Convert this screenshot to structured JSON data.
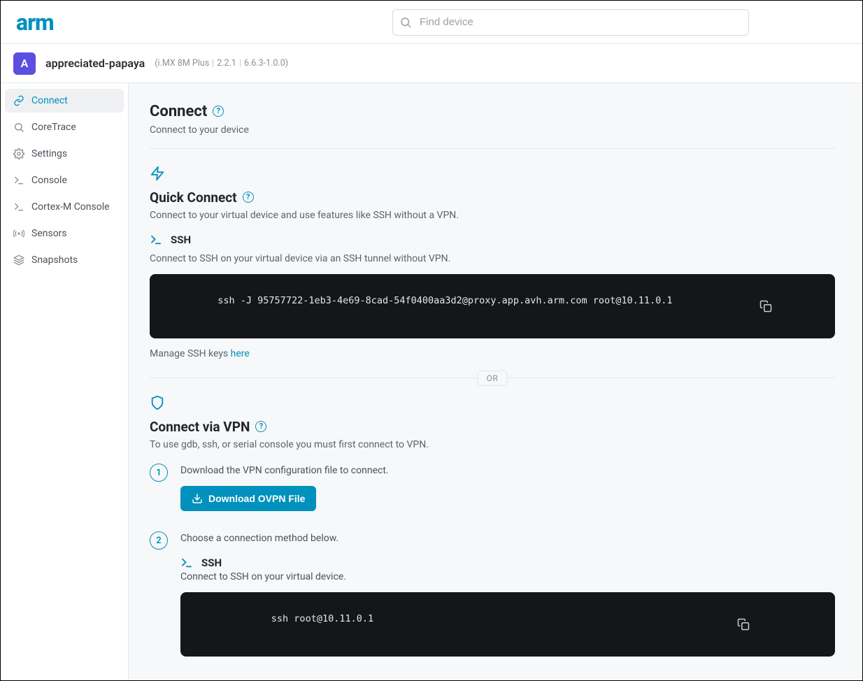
{
  "brand": "arm",
  "search": {
    "placeholder": "Find device"
  },
  "device": {
    "avatar": "A",
    "name": "appreciated-papaya",
    "meta_prefix": "(",
    "meta_model": "i.MX 8M Plus",
    "meta_fw": "2.2.1",
    "meta_kernel": "6.6.3-1.0.0",
    "meta_suffix": ")"
  },
  "sidebar": {
    "items": [
      {
        "id": "connect",
        "label": "Connect",
        "icon": "link-icon",
        "active": true
      },
      {
        "id": "coretrace",
        "label": "CoreTrace",
        "icon": "magnifier-icon",
        "active": false
      },
      {
        "id": "settings",
        "label": "Settings",
        "icon": "gear-icon",
        "active": false
      },
      {
        "id": "console",
        "label": "Console",
        "icon": "terminal-icon",
        "active": false
      },
      {
        "id": "cortexm",
        "label": "Cortex-M Console",
        "icon": "terminal-icon",
        "active": false
      },
      {
        "id": "sensors",
        "label": "Sensors",
        "icon": "signal-icon",
        "active": false
      },
      {
        "id": "snapshots",
        "label": "Snapshots",
        "icon": "stack-icon",
        "active": false
      }
    ]
  },
  "connect": {
    "title": "Connect",
    "subtitle": "Connect to your device",
    "quick": {
      "title": "Quick Connect",
      "subtitle": "Connect to your virtual device and use features like SSH without a VPN.",
      "ssh_label": "SSH",
      "ssh_desc": "Connect to SSH on your virtual device via an SSH tunnel without VPN.",
      "ssh_cmd": "ssh -J 95757722-1eb3-4e69-8cad-54f0400aa3d2@proxy.app.avh.arm.com root@10.11.0.1",
      "manage_prefix": "Manage SSH keys ",
      "manage_link": "here"
    },
    "or_label": "OR",
    "vpn": {
      "title": "Connect via VPN",
      "subtitle": "To use gdb, ssh, or serial console you must first connect to VPN.",
      "step1_text": "Download the VPN configuration file to connect.",
      "download_label": "Download OVPN File",
      "step2_text": "Choose a connection method below.",
      "ssh_label": "SSH",
      "ssh_desc": "Connect to SSH on your virtual device.",
      "ssh_cmd": "ssh root@10.11.0.1"
    }
  }
}
